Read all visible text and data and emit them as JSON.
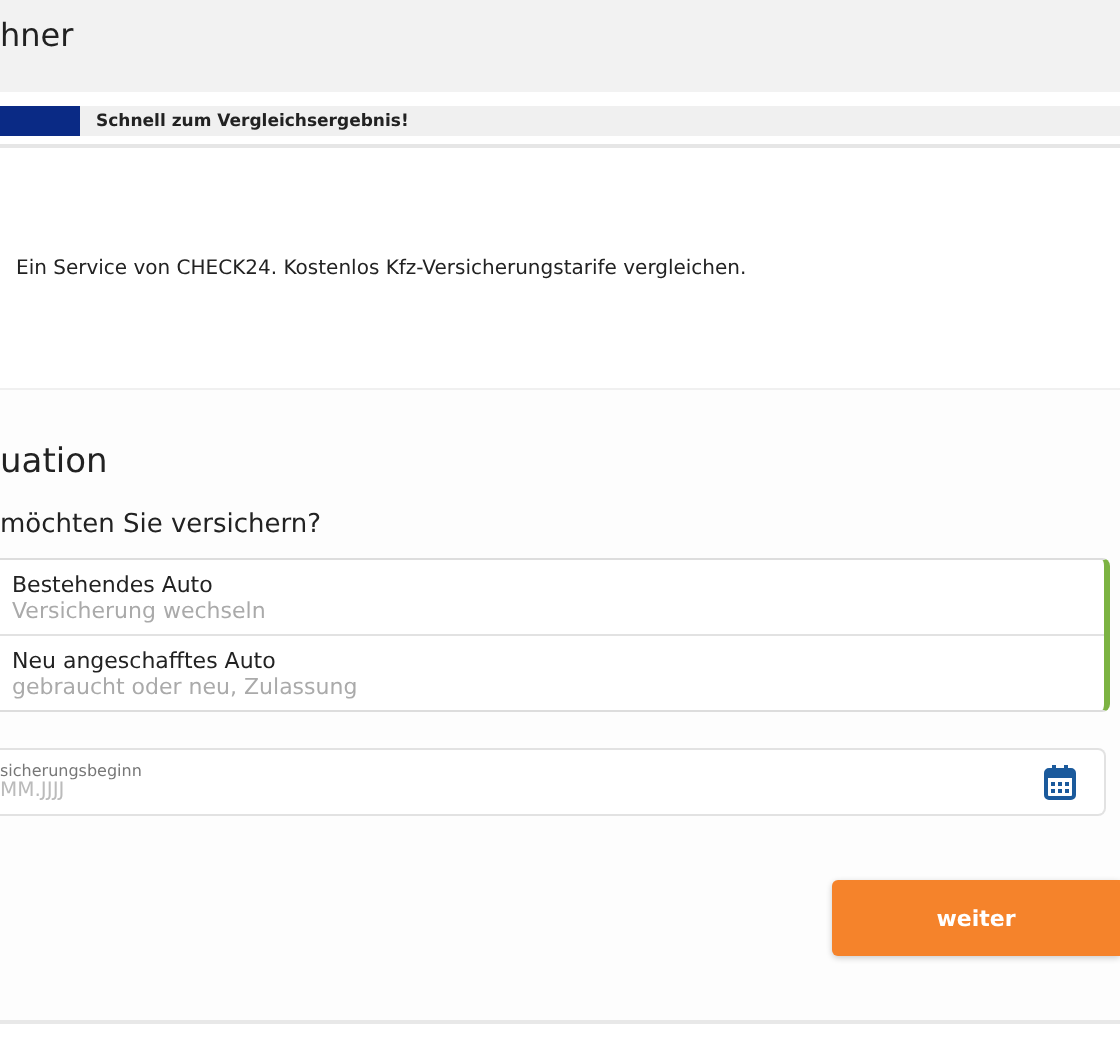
{
  "header": {
    "title": "hner"
  },
  "banner": {
    "text": "Schnell zum Vergleichsergebnis!"
  },
  "intro": {
    "text": "Ein Service von CHECK24. Kostenlos Kfz-Versicherungstarife vergleichen."
  },
  "section": {
    "title": "uation",
    "question": "möchten Sie versichern?",
    "options_valid": true,
    "options": [
      {
        "label": "Bestehendes Auto",
        "hint": "Versicherung wechseln",
        "selected": false
      },
      {
        "label": "Neu angeschafftes Auto",
        "hint": "gebraucht oder neu, Zulassung",
        "selected": false
      }
    ],
    "date_field": {
      "label": "sicherungsbeginn",
      "placeholder": "MM.JJJJ"
    }
  },
  "button": {
    "label": "weiter"
  }
}
